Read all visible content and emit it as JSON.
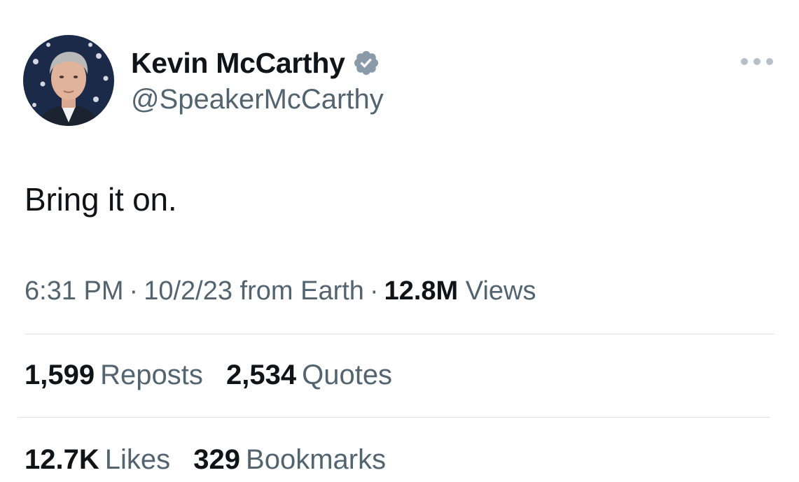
{
  "user": {
    "display_name": "Kevin McCarthy",
    "handle": "@SpeakerMcCarthy",
    "verified_icon": "verified-badge-icon",
    "verified_color": "#8a9aa8"
  },
  "tweet": {
    "text": "Bring it on.",
    "time": "6:31 PM",
    "date": "10/2/23",
    "source": "from Earth",
    "views_count": "12.8M",
    "views_label": "Views"
  },
  "stats": {
    "reposts_count": "1,599",
    "reposts_label": "Reposts",
    "quotes_count": "2,534",
    "quotes_label": "Quotes",
    "likes_count": "12.7K",
    "likes_label": "Likes",
    "bookmarks_count": "329",
    "bookmarks_label": "Bookmarks"
  },
  "menu": {
    "icon": "more-options-icon"
  },
  "colors": {
    "primary_text": "#0f1419",
    "secondary_text": "#536471",
    "divider": "#dfe3e6"
  }
}
